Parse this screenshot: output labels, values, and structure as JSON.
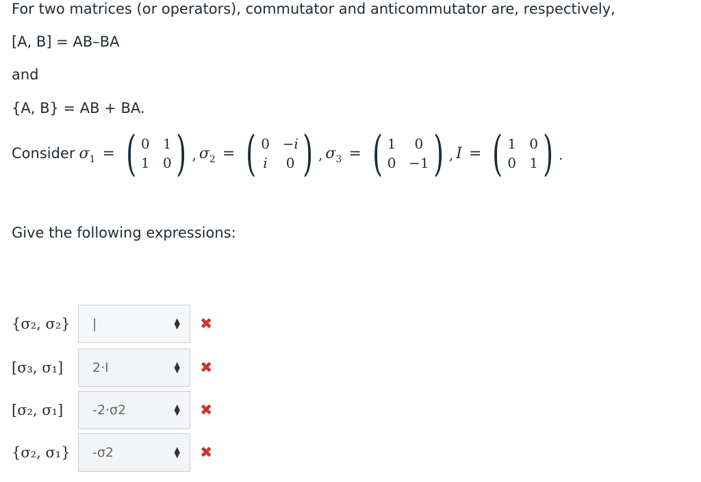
{
  "intro": "For two matrices (or operators), commutator and anticommutator are, respectively,",
  "commutator_def": "[A, B]  =  AB–BA",
  "and_word": "and",
  "anticommutator_def": "{A, B}  =  AB  +  BA.",
  "consider_word": "Consider",
  "matrices": [
    {
      "symbol": "σ",
      "sub": "1",
      "cells": [
        "0",
        "1",
        "1",
        "0"
      ]
    },
    {
      "symbol": "σ",
      "sub": "2",
      "cells": [
        "0",
        "−i",
        "i",
        "0"
      ]
    },
    {
      "symbol": "σ",
      "sub": "3",
      "cells": [
        "1",
        "0",
        "0",
        "−1"
      ]
    },
    {
      "symbol": "I",
      "sub": "",
      "cells": [
        "1",
        "0",
        "0",
        "1"
      ]
    }
  ],
  "prompt": "Give the following expressions:",
  "questions": [
    {
      "label": "{σ₂, σ₂}",
      "value": "|",
      "status": "✖"
    },
    {
      "label": "[σ₃, σ₁]",
      "value": "2·I",
      "status": "✖"
    },
    {
      "label": "[σ₂, σ₁]",
      "value": "-2·σ2",
      "status": "✖"
    },
    {
      "label": "{σ₂, σ₁}",
      "value": "-σ2",
      "status": "✖"
    }
  ]
}
